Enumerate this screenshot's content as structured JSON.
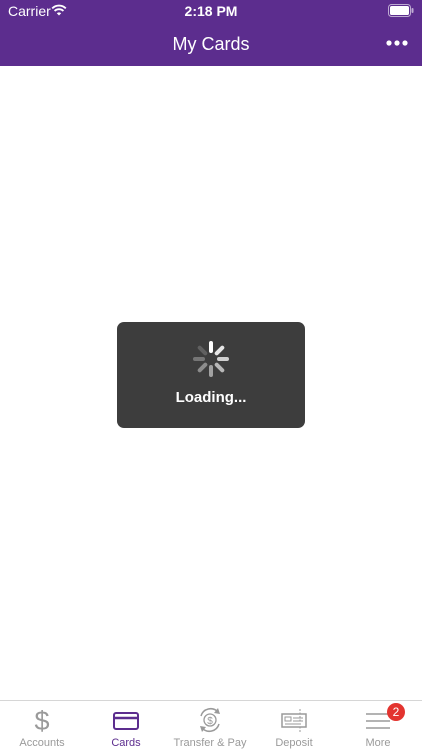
{
  "status_bar": {
    "carrier": "Carrier",
    "time": "2:18 PM"
  },
  "header": {
    "title": "My Cards",
    "more_icon": "more-horizontal-icon"
  },
  "loading": {
    "text": "Loading..."
  },
  "colors": {
    "brand": "#5c2d8e",
    "hud": "#3d3d3d",
    "badge": "#e3342f"
  },
  "tab_bar": {
    "items": [
      {
        "label": "Accounts",
        "icon": "dollar-icon",
        "active": false
      },
      {
        "label": "Cards",
        "icon": "card-icon",
        "active": true
      },
      {
        "label": "Transfer & Pay",
        "icon": "transfer-pay-icon",
        "active": false
      },
      {
        "label": "Deposit",
        "icon": "check-deposit-icon",
        "active": false
      },
      {
        "label": "More",
        "icon": "menu-icon",
        "active": false,
        "badge": "2"
      }
    ]
  }
}
